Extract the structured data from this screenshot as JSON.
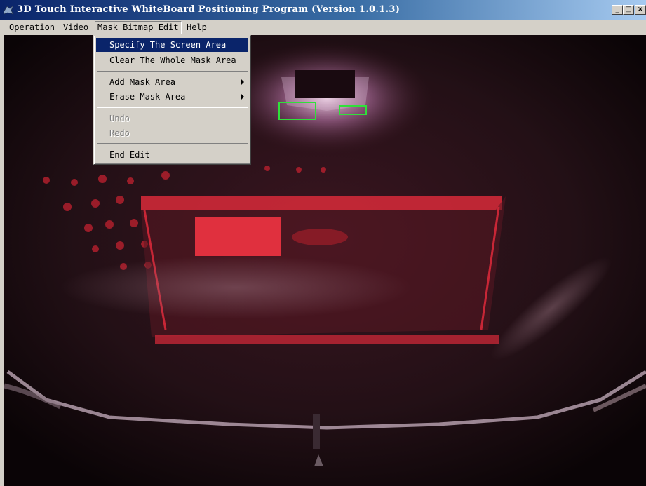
{
  "window": {
    "title": "3D Touch Interactive WhiteBoard Positioning Program (Version 1.0.1.3)",
    "minimize_glyph": "_",
    "maximize_glyph": "□",
    "close_glyph": "×"
  },
  "menubar": {
    "items": [
      {
        "label": "Operation"
      },
      {
        "label": "Video"
      },
      {
        "label": "Mask Bitmap Edit",
        "active": true
      },
      {
        "label": "Help"
      }
    ]
  },
  "dropdown": {
    "items": [
      {
        "label": "Specify The Screen Area",
        "selected": true
      },
      {
        "label": "Clear The Whole Mask Area"
      },
      {
        "label": "Add Mask Area",
        "submenu": true
      },
      {
        "label": "Erase Mask Area",
        "submenu": true
      },
      {
        "label": "Undo",
        "disabled": true
      },
      {
        "label": "Redo",
        "disabled": true
      },
      {
        "label": "End Edit"
      }
    ]
  },
  "colors": {
    "title_gradient_start": "#0a246a",
    "title_gradient_end": "#a6caf0",
    "menu_background": "#d4d0c8",
    "selection_highlight": "#0a246a",
    "detection_box": "#2fe03a",
    "infrared_red": "#d82a3a"
  },
  "icons": {
    "app_icon": "app-icon",
    "submenu_arrow": "chevron-right-icon"
  }
}
